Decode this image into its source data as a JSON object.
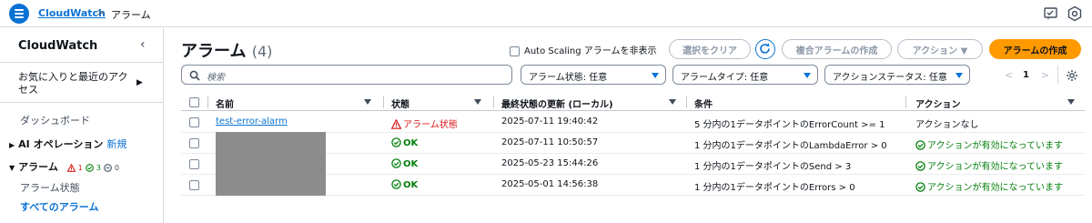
{
  "breadcrumb": {
    "service": "CloudWatch",
    "separator": ">",
    "current": "アラーム"
  },
  "sidebar": {
    "title": "CloudWatch",
    "favorites": "お気に入りと最近のアクセス",
    "dashboard": "ダッシュボード",
    "ai_ops": {
      "label": "AI オペレーション",
      "badge": "新規"
    },
    "alarms": {
      "label": "アラーム",
      "alarm_count": "1",
      "ok_count": "3",
      "insufficient_count": "0"
    },
    "alarm_state": "アラーム状態",
    "all_alarms": "すべてのアラーム"
  },
  "main": {
    "title": "アラーム",
    "count": "(4)",
    "hide_autoscaling": "Auto Scaling アラームを非表示",
    "buttons": {
      "clear": "選択をクリア",
      "create_composite": "複合アラームの作成",
      "actions": "アクション ▼",
      "create_alarm": "アラームの作成"
    },
    "search_placeholder": "検索",
    "filters": {
      "alarm_state": "アラーム状態: 任意",
      "alarm_type": "アラームタイプ: 任意",
      "action_status": "アクションステータス: 任意"
    },
    "pager": {
      "prev": "<",
      "page": "1",
      "next": ">"
    }
  },
  "table": {
    "headers": {
      "name": "名前",
      "state": "状態",
      "updated": "最終状態の更新 (ローカル)",
      "conditions": "条件",
      "actions": "アクション"
    },
    "rows": [
      {
        "name": "test-error-alarm",
        "state": "アラーム状態",
        "updated": "2025-07-11 19:40:42",
        "condition": "5 分内の1データポイントのErrorCount >= 1",
        "action": "アクションなし"
      },
      {
        "name": "",
        "state": "OK",
        "updated": "2025-07-11 10:50:57",
        "condition": "1 分内の1データポイントのLambdaError > 0",
        "action": "アクションが有効になっています"
      },
      {
        "name": "",
        "state": "OK",
        "updated": "2025-05-23 15:44:26",
        "condition": "1 分内の1データポイントのSend > 3",
        "action": "アクションが有効になっています"
      },
      {
        "name": "",
        "state": "OK",
        "updated": "2025-05-01 14:56:38",
        "condition": "1 分内の1データポイントのErrors > 0",
        "action": "アクションが有効になっています"
      }
    ]
  },
  "colors": {
    "link": "#0972d3",
    "primary": "#ff9900",
    "alarm": "#d91515",
    "ok": "#037f0c"
  }
}
